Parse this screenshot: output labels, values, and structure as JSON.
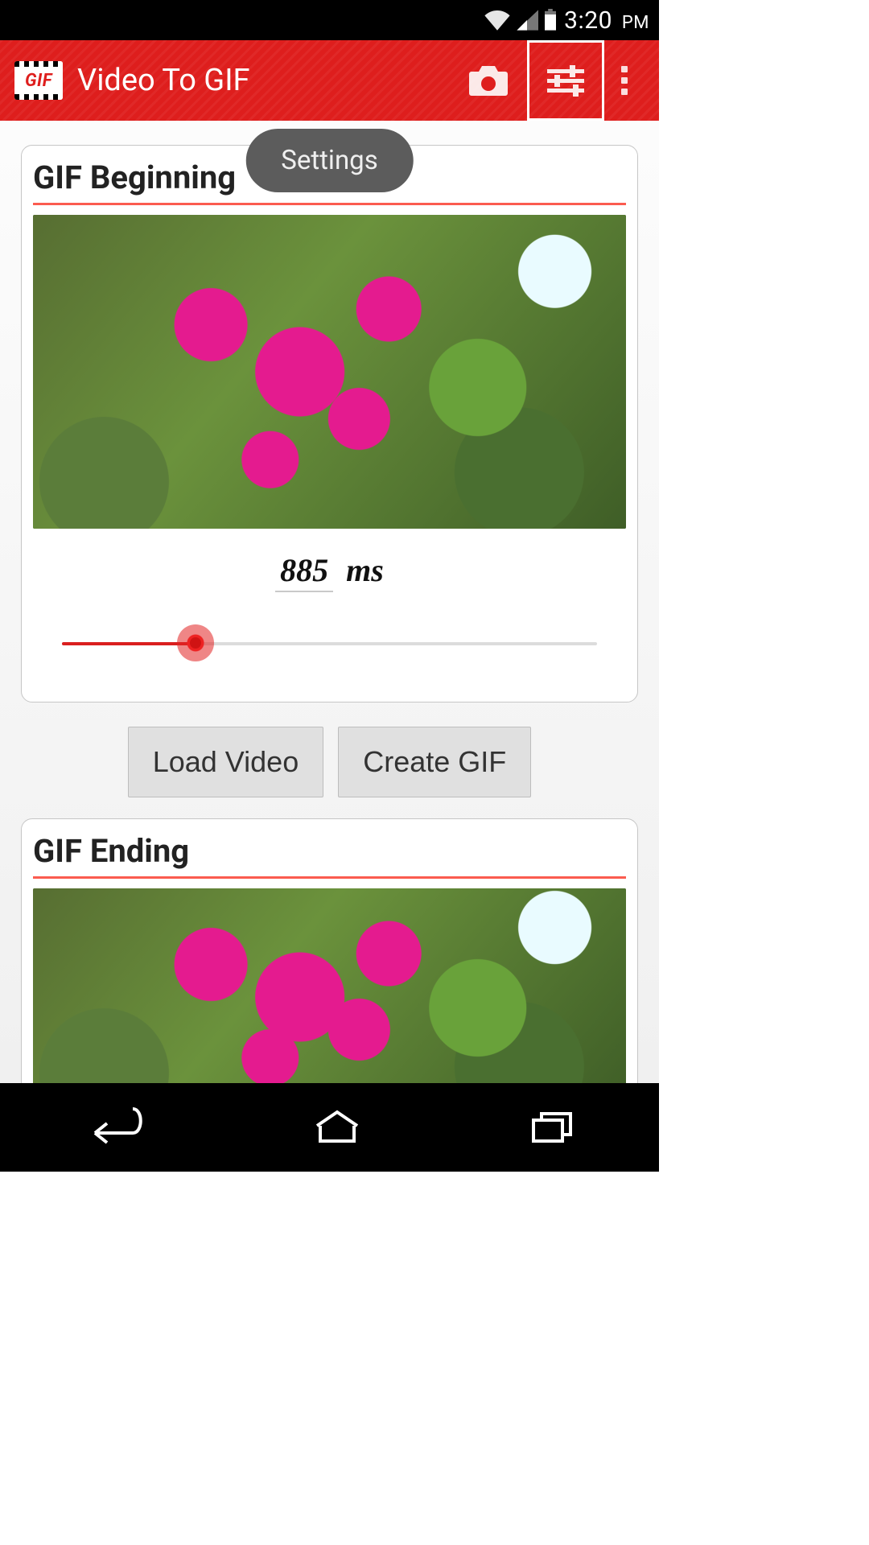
{
  "status": {
    "time": "3:20",
    "ampm": "PM"
  },
  "appbar": {
    "logo_text": "GIF",
    "title": "Video To GIF",
    "tooltip": "Settings"
  },
  "beginning": {
    "title": "GIF Beginning",
    "time_value": "885",
    "time_unit": "ms",
    "slider_percent": 25
  },
  "buttons": {
    "load": "Load Video",
    "create": "Create GIF"
  },
  "ending": {
    "title": "GIF Ending"
  }
}
